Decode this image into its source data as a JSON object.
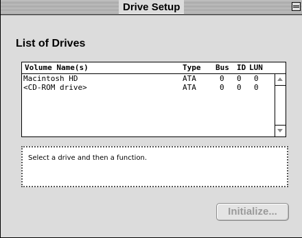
{
  "window": {
    "title": "Drive Setup"
  },
  "section": {
    "title": "List of Drives"
  },
  "columns": {
    "volume": "Volume Name(s)",
    "type": "Type",
    "bus": "Bus",
    "id": "ID",
    "lun": "LUN"
  },
  "drives": [
    {
      "name": "Macintosh HD",
      "type": "ATA",
      "bus": "0",
      "id": "0",
      "lun": "0"
    },
    {
      "name": "<CD-ROM drive>",
      "type": "ATA",
      "bus": "0",
      "id": "0",
      "lun": "0"
    }
  ],
  "info": {
    "message": "Select a drive and then a function."
  },
  "buttons": {
    "initialize": "Initialize..."
  }
}
